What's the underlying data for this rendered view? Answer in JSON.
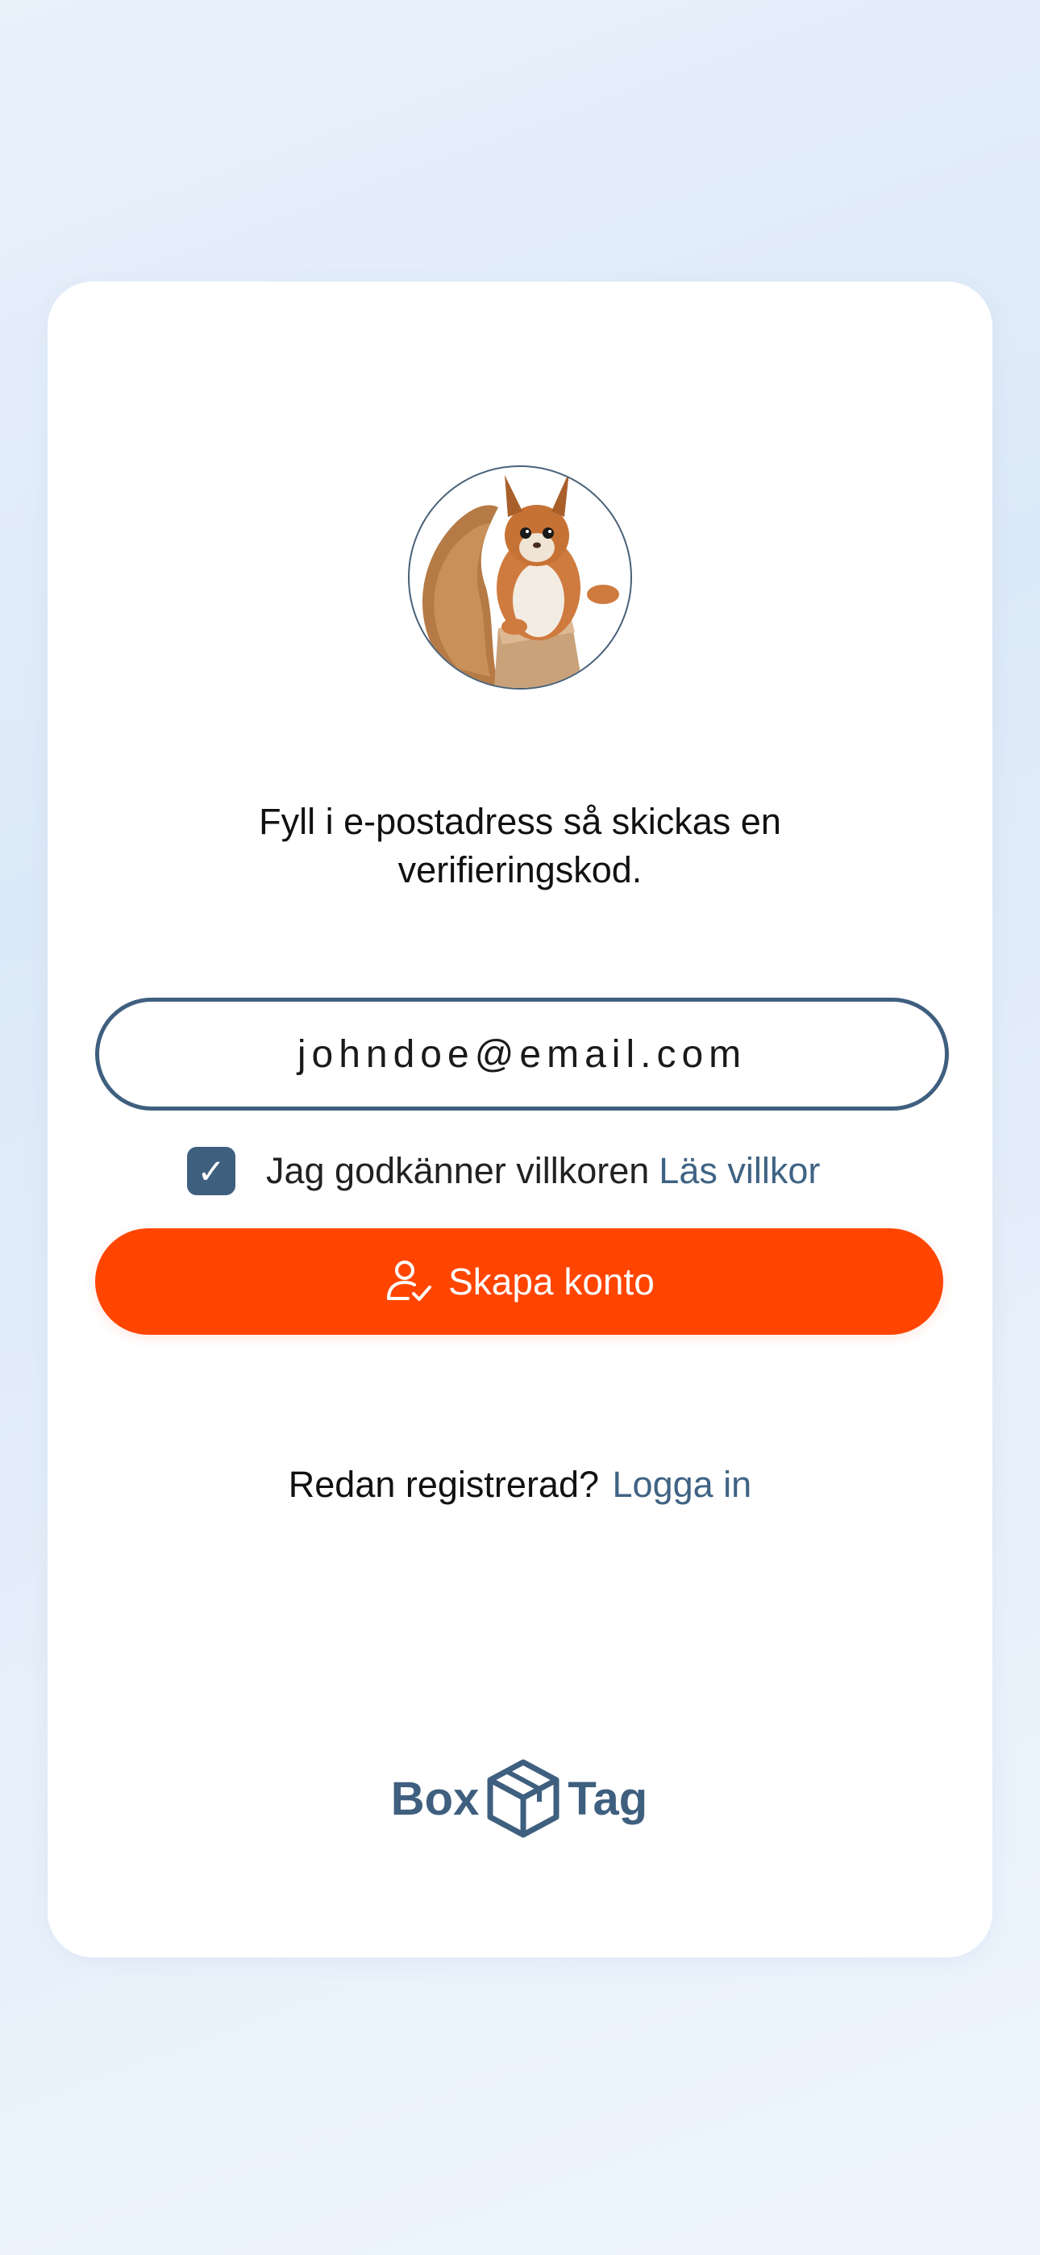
{
  "instructions": "Fyll i e-postadress så skickas en verifieringskod.",
  "email_field": {
    "value": "johndoe@email.com"
  },
  "terms": {
    "checked": true,
    "check_glyph": "✓",
    "text": "Jag godkänner villkoren",
    "link": "Läs villkor"
  },
  "create_button": {
    "icon": "user-check-icon",
    "label": "Skapa konto"
  },
  "login": {
    "prompt": "Redan registrerad?",
    "link": "Logga in"
  },
  "logo": {
    "left": "Box",
    "right": "Tag"
  },
  "colors": {
    "primary": "#3f5f7f",
    "accent": "#ff4500",
    "link": "#3f6384",
    "card": "#ffffff"
  }
}
